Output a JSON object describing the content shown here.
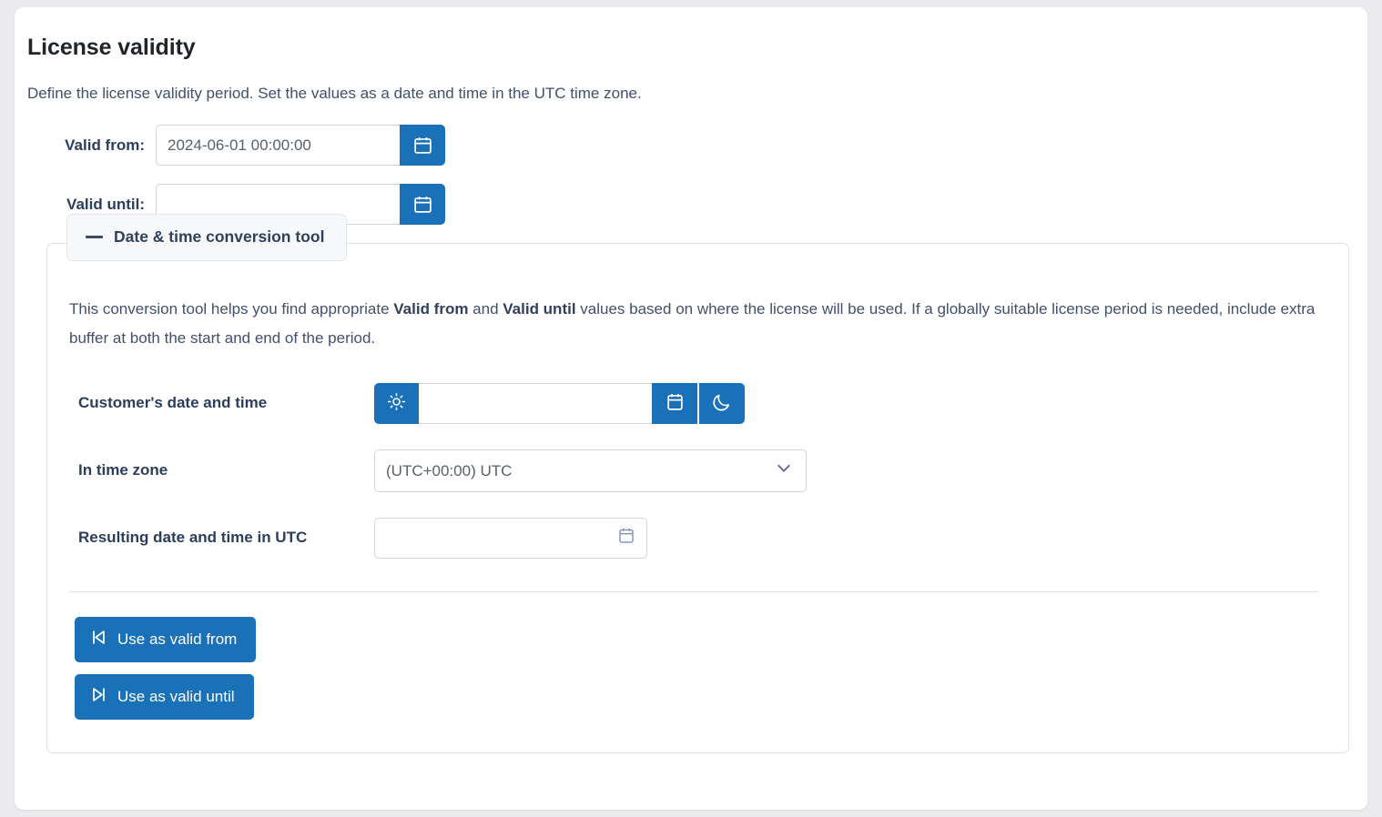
{
  "page": {
    "title": "License validity",
    "description": "Define the license validity period. Set the values as a date and time in the UTC time zone."
  },
  "fields": {
    "valid_from": {
      "label": "Valid from:",
      "value": "2024-06-01 00:00:00",
      "placeholder": "",
      "picker_icon": "calendar-icon"
    },
    "valid_until": {
      "label": "Valid until:",
      "value": "",
      "placeholder": "",
      "picker_icon": "calendar-icon"
    }
  },
  "conversion_tool": {
    "legend": "Date & time conversion tool",
    "collapse_icon": "minus-icon",
    "description_part1": "This conversion tool helps you find appropriate ",
    "bold1": "Valid from",
    "description_part2": " and ",
    "bold2": "Valid until",
    "description_part3": " values based on where the license will be used. If a globally suitable license period is needed, include extra buffer at both the start and end of the period.",
    "customer_datetime": {
      "label": "Customer's date and time",
      "value": "",
      "placeholder": "",
      "start_of_day_icon": "sun-icon",
      "calendar_icon": "calendar-icon",
      "end_of_day_icon": "moon-icon"
    },
    "time_zone": {
      "label": "In time zone",
      "selected": "(UTC+00:00) UTC",
      "options": [
        "(UTC+00:00) UTC"
      ],
      "chevron_icon": "chevron-down-icon"
    },
    "result": {
      "label": "Resulting date and time in UTC",
      "value": "",
      "placeholder": "",
      "calendar_icon": "calendar-icon"
    },
    "actions": {
      "use_as_valid_from": {
        "label": "Use as valid from",
        "icon": "skip-to-start-icon"
      },
      "use_as_valid_until": {
        "label": "Use as valid until",
        "icon": "skip-to-end-icon"
      }
    }
  },
  "colors": {
    "accent": "#1b71b8",
    "card": "#ffffff",
    "page_background": "#ececef",
    "label_text": "#2c3e5d",
    "body_text": "#41506b",
    "border": "#ced4da"
  }
}
